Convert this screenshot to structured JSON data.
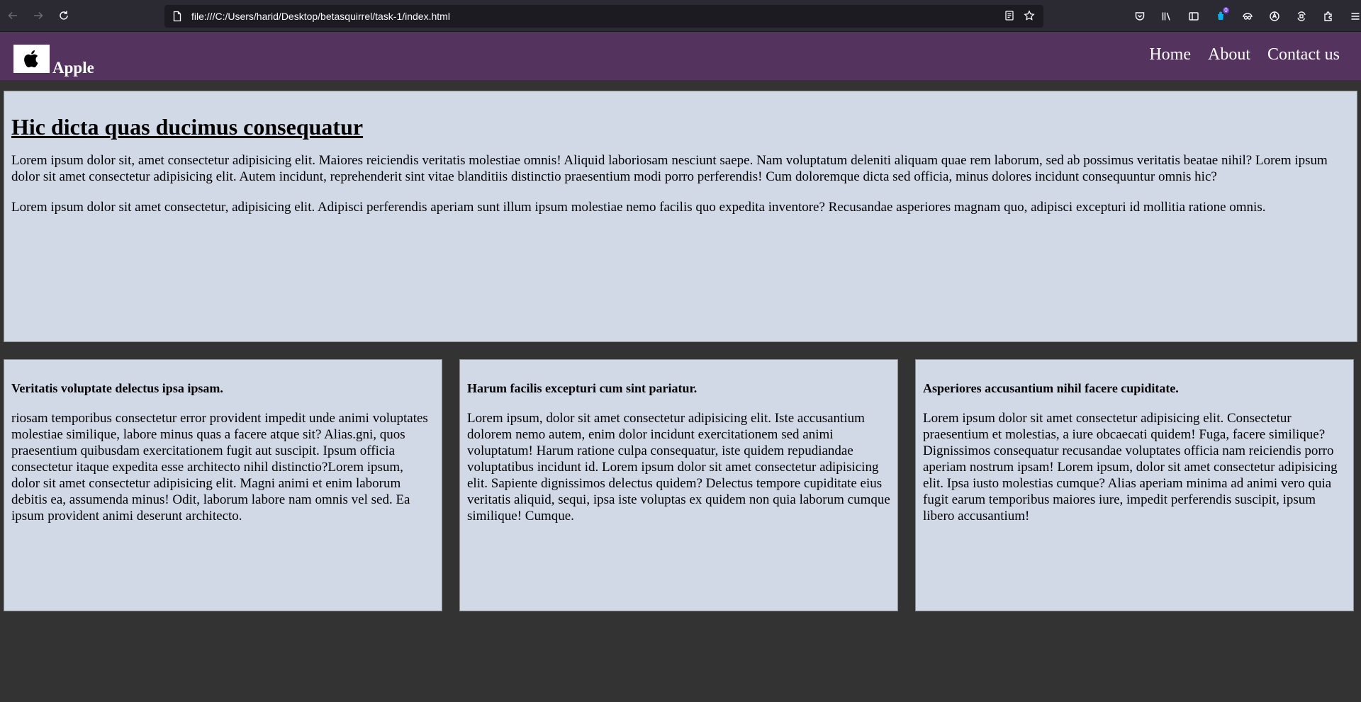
{
  "browser": {
    "url": "file:///C:/Users/harid/Desktop/betasquirrel/task-1/index.html",
    "extension_badge": "0",
    "icons": {
      "back": "back-arrow-icon",
      "forward": "forward-arrow-icon",
      "reload": "reload-icon",
      "page": "page-icon",
      "reader": "reader-view-icon",
      "bookmark": "star-icon",
      "pocket": "pocket-icon",
      "library": "library-icon",
      "sidebar": "sidebar-icon",
      "account": "account-icon",
      "extensions": "puzzle-icon",
      "menu": "hamburger-menu-icon"
    }
  },
  "header": {
    "brand": "Apple",
    "logo": "apple-logo-icon",
    "nav": [
      "Home",
      "About",
      "Contact us"
    ]
  },
  "hero": {
    "title": "Hic dicta quas ducimus consequatur",
    "paragraphs": [
      "Lorem ipsum dolor sit, amet consectetur adipisicing elit. Maiores reiciendis veritatis molestiae omnis! Aliquid laboriosam nesciunt saepe. Nam voluptatum deleniti aliquam quae rem laborum, sed ab possimus veritatis beatae nihil? Lorem ipsum dolor sit amet consectetur adipisicing elit. Autem incidunt, reprehenderit sint vitae blanditiis distinctio praesentium modi porro perferendis! Cum doloremque dicta sed officia, minus dolores incidunt consequuntur omnis hic?",
      "Lorem ipsum dolor sit amet consectetur, adipisicing elit. Adipisci perferendis aperiam sunt illum ipsum molestiae nemo facilis quo expedita inventore? Recusandae asperiores magnam quo, adipisci excepturi id mollitia ratione omnis."
    ]
  },
  "cards": [
    {
      "title": "Veritatis voluptate delectus ipsa ipsam.",
      "body": "riosam temporibus consectetur error provident impedit unde animi voluptates molestiae similique, labore minus quas a facere atque sit? Alias.gni, quos praesentium quibusdam exercitationem fugit aut suscipit. Ipsum officia consectetur itaque expedita esse architecto nihil distinctio?Lorem ipsum, dolor sit amet consectetur adipisicing elit. Magni animi et enim laborum debitis ea, assumenda minus! Odit, laborum labore nam omnis vel sed. Ea ipsum provident animi deserunt architecto."
    },
    {
      "title": "Harum facilis excepturi cum sint pariatur.",
      "body": "Lorem ipsum, dolor sit amet consectetur adipisicing elit. Iste accusantium dolorem nemo autem, enim dolor incidunt exercitationem sed animi voluptatum! Harum ratione culpa consequatur, iste quidem repudiandae voluptatibus incidunt id. Lorem ipsum dolor sit amet consectetur adipisicing elit. Sapiente dignissimos delectus quidem? Delectus tempore cupiditate eius veritatis aliquid, sequi, ipsa iste voluptas ex quidem non quia laborum cumque similique! Cumque."
    },
    {
      "title": "Asperiores accusantium nihil facere cupiditate.",
      "body": "Lorem ipsum dolor sit amet consectetur adipisicing elit. Consectetur praesentium et molestias, a iure obcaecati quidem! Fuga, facere similique? Dignissimos consequatur recusandae voluptates officia nam reiciendis porro aperiam nostrum ipsam! Lorem ipsum, dolor sit amet consectetur adipisicing elit. Ipsa iusto molestias cumque? Alias aperiam minima ad animi vero quia fugit earum temporibus maiores iure, impedit perferendis suscipit, ipsum libero accusantium!"
    }
  ],
  "colors": {
    "page_background": "#333333",
    "header_background": "#54345f",
    "panel_background": "#d1d9e7",
    "browser_chrome": "#2b2a33"
  }
}
